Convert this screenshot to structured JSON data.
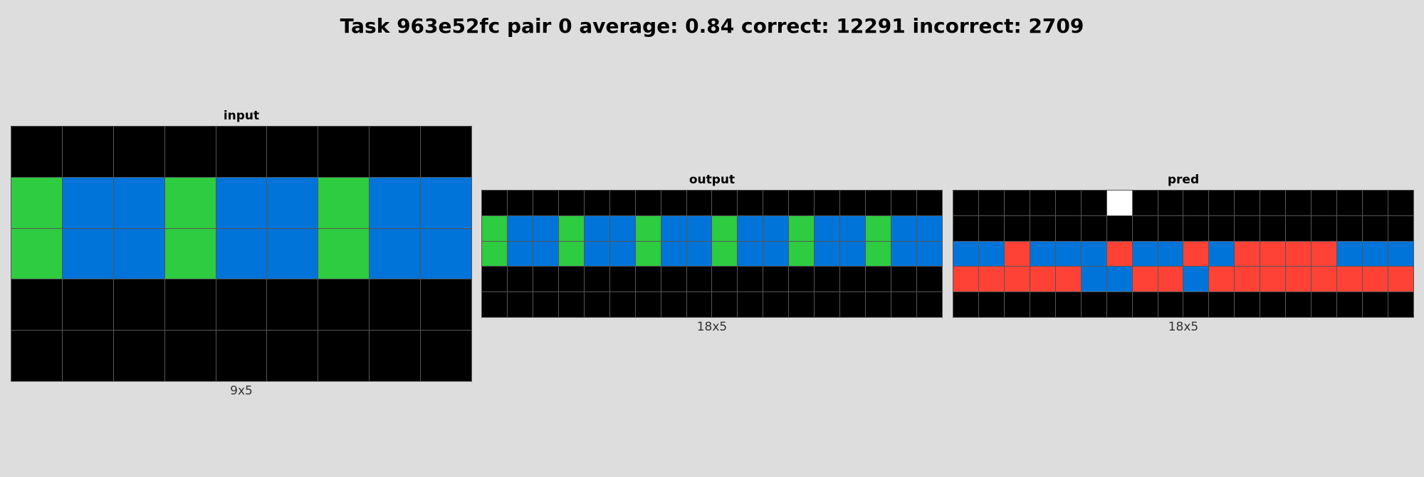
{
  "title": "Task 963e52fc pair 0 average: 0.84 correct: 12291 incorrect: 2709",
  "palette": {
    "0": "#000000",
    "1": "#0074D9",
    "2": "#FF4136",
    "3": "#2ECC40",
    "5": "#FFFFFF"
  },
  "panels": [
    {
      "label": "input",
      "dims": "9x5",
      "grid": [
        [
          0,
          0,
          0,
          0,
          0,
          0,
          0,
          0,
          0
        ],
        [
          3,
          1,
          1,
          3,
          1,
          1,
          3,
          1,
          1
        ],
        [
          3,
          1,
          1,
          3,
          1,
          1,
          3,
          1,
          1
        ],
        [
          0,
          0,
          0,
          0,
          0,
          0,
          0,
          0,
          0
        ],
        [
          0,
          0,
          0,
          0,
          0,
          0,
          0,
          0,
          0
        ]
      ]
    },
    {
      "label": "output",
      "dims": "18x5",
      "grid": [
        [
          0,
          0,
          0,
          0,
          0,
          0,
          0,
          0,
          0,
          0,
          0,
          0,
          0,
          0,
          0,
          0,
          0,
          0
        ],
        [
          3,
          1,
          1,
          3,
          1,
          1,
          3,
          1,
          1,
          3,
          1,
          1,
          3,
          1,
          1,
          3,
          1,
          1
        ],
        [
          3,
          1,
          1,
          3,
          1,
          1,
          3,
          1,
          1,
          3,
          1,
          1,
          3,
          1,
          1,
          3,
          1,
          1
        ],
        [
          0,
          0,
          0,
          0,
          0,
          0,
          0,
          0,
          0,
          0,
          0,
          0,
          0,
          0,
          0,
          0,
          0,
          0
        ],
        [
          0,
          0,
          0,
          0,
          0,
          0,
          0,
          0,
          0,
          0,
          0,
          0,
          0,
          0,
          0,
          0,
          0,
          0
        ]
      ]
    },
    {
      "label": "pred",
      "dims": "18x5",
      "grid": [
        [
          0,
          0,
          0,
          0,
          0,
          0,
          5,
          0,
          0,
          0,
          0,
          0,
          0,
          0,
          0,
          0,
          0,
          0
        ],
        [
          0,
          0,
          0,
          0,
          0,
          0,
          0,
          0,
          0,
          0,
          0,
          0,
          0,
          0,
          0,
          0,
          0,
          0
        ],
        [
          1,
          1,
          2,
          1,
          1,
          1,
          2,
          1,
          1,
          2,
          1,
          2,
          2,
          2,
          2,
          1,
          1,
          1
        ],
        [
          2,
          2,
          2,
          2,
          2,
          1,
          1,
          2,
          2,
          1,
          2,
          2,
          2,
          2,
          2,
          2,
          2,
          2
        ],
        [
          0,
          0,
          0,
          0,
          0,
          0,
          0,
          0,
          0,
          0,
          0,
          0,
          0,
          0,
          0,
          0,
          0,
          0
        ]
      ]
    }
  ]
}
